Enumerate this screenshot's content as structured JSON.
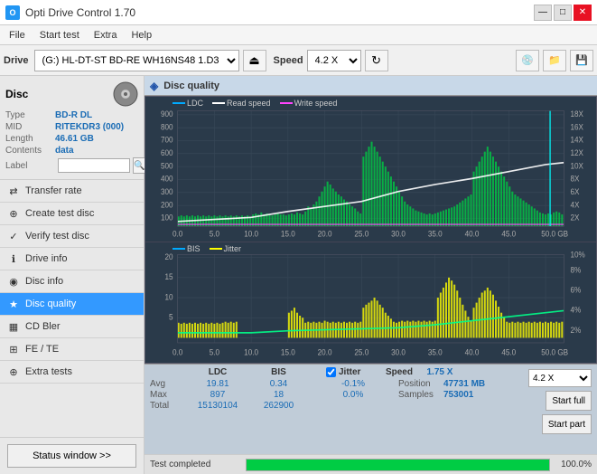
{
  "titlebar": {
    "title": "Opti Drive Control 1.70",
    "icon_text": "O",
    "minimize": "—",
    "maximize": "□",
    "close": "✕"
  },
  "menubar": {
    "items": [
      "File",
      "Start test",
      "Extra",
      "Help"
    ]
  },
  "toolbar": {
    "drive_label": "Drive",
    "drive_value": "(G:)  HL-DT-ST BD-RE  WH16NS48 1.D3",
    "speed_label": "Speed",
    "speed_value": "4.2 X"
  },
  "disc": {
    "title": "Disc",
    "type_label": "Type",
    "type_value": "BD-R DL",
    "mid_label": "MID",
    "mid_value": "RITEKDR3 (000)",
    "length_label": "Length",
    "length_value": "46.61 GB",
    "contents_label": "Contents",
    "contents_value": "data",
    "label_label": "Label",
    "label_value": ""
  },
  "nav": {
    "items": [
      {
        "id": "transfer-rate",
        "label": "Transfer rate",
        "icon": "⇄"
      },
      {
        "id": "create-test-disc",
        "label": "Create test disc",
        "icon": "⊕"
      },
      {
        "id": "verify-test-disc",
        "label": "Verify test disc",
        "icon": "✓"
      },
      {
        "id": "drive-info",
        "label": "Drive info",
        "icon": "ℹ"
      },
      {
        "id": "disc-info",
        "label": "Disc info",
        "icon": "◉"
      },
      {
        "id": "disc-quality",
        "label": "Disc quality",
        "icon": "★",
        "active": true
      },
      {
        "id": "cd-bler",
        "label": "CD Bler",
        "icon": "▦"
      },
      {
        "id": "fe-te",
        "label": "FE / TE",
        "icon": "⊞"
      },
      {
        "id": "extra-tests",
        "label": "Extra tests",
        "icon": "⊕"
      }
    ],
    "status_btn": "Status window >>"
  },
  "content": {
    "title": "Disc quality",
    "legend": {
      "ldc": {
        "label": "LDC",
        "color": "#00aaff"
      },
      "read_speed": {
        "label": "Read speed",
        "color": "#ffffff"
      },
      "write_speed": {
        "label": "Write speed",
        "color": "#ff44ff"
      }
    },
    "top_chart": {
      "y_axis_left": [
        900,
        800,
        700,
        600,
        500,
        400,
        300,
        200,
        100
      ],
      "y_axis_right": [
        "18X",
        "16X",
        "14X",
        "12X",
        "10X",
        "8X",
        "6X",
        "4X",
        "2X"
      ],
      "x_axis": [
        "0.0",
        "5.0",
        "10.0",
        "15.0",
        "20.0",
        "25.0",
        "30.0",
        "35.0",
        "40.0",
        "45.0",
        "50.0 GB"
      ]
    },
    "bottom_chart": {
      "title1": "BIS",
      "title2": "Jitter",
      "y_axis_left": [
        20,
        15,
        10,
        5
      ],
      "y_axis_right": [
        "10%",
        "8%",
        "6%",
        "4%",
        "2%"
      ],
      "x_axis": [
        "0.0",
        "5.0",
        "10.0",
        "15.0",
        "20.0",
        "25.0",
        "30.0",
        "35.0",
        "40.0",
        "45.0",
        "50.0 GB"
      ]
    }
  },
  "stats": {
    "headers": [
      "",
      "LDC",
      "BIS",
      "",
      "Jitter",
      "Speed",
      "1.75 X"
    ],
    "avg_label": "Avg",
    "avg_ldc": "19.81",
    "avg_bis": "0.34",
    "avg_jitter": "-0.1%",
    "max_label": "Max",
    "max_ldc": "897",
    "max_bis": "18",
    "max_jitter": "0.0%",
    "total_label": "Total",
    "total_ldc": "15130104",
    "total_bis": "262900",
    "position_label": "Position",
    "position_value": "47731 MB",
    "samples_label": "Samples",
    "samples_value": "753001",
    "speed_select": "4.2 X",
    "start_full": "Start full",
    "start_part": "Start part",
    "jitter_checked": true,
    "jitter_label": "Jitter"
  },
  "statusbar": {
    "text": "Test completed",
    "progress": 100.0,
    "progress_text": "100.0%"
  }
}
